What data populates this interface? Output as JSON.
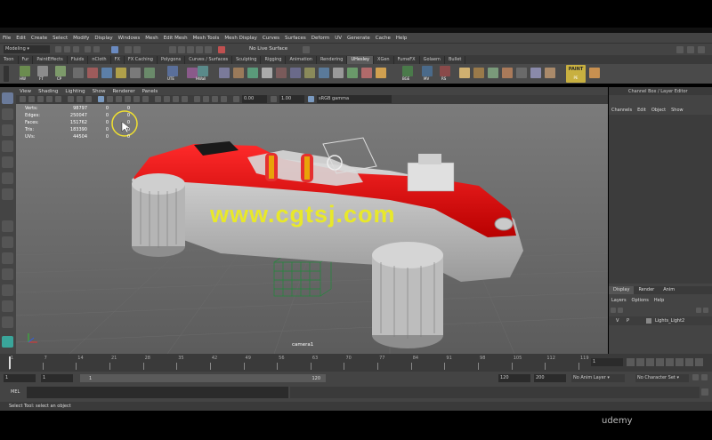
{
  "menu": [
    "File",
    "Edit",
    "Create",
    "Select",
    "Modify",
    "Display",
    "Windows",
    "Mesh",
    "Edit Mesh",
    "Mesh Tools",
    "Mesh Display",
    "Curves",
    "Surfaces",
    "Deform",
    "UV",
    "Generate",
    "Cache",
    "Help"
  ],
  "status_line": {
    "mode": "Modeling",
    "live_surface": "No Live Surface"
  },
  "shelf_tabs": [
    "Toon",
    "Fur",
    "PaintEffects",
    "Fluids",
    "nCloth",
    "FX",
    "FX Caching",
    "Polygons",
    "Curves / Surfaces",
    "Sculpting",
    "Rigging",
    "Animation",
    "Rendering",
    "UHesley",
    "XGen",
    "FumeFX",
    "Golaem",
    "Bullet"
  ],
  "active_shelf_tab": "UHesley",
  "shelf_icon_labels": [
    "HW",
    "FT",
    "CP",
    "UTE",
    "HWall",
    "BGE",
    "MV",
    "RS",
    "PE"
  ],
  "shelf_paint_label": "PAINT",
  "viewport_menu": [
    "View",
    "Shading",
    "Lighting",
    "Show",
    "Renderer",
    "Panels"
  ],
  "viewport_toolbar": {
    "value1": "0.00",
    "value2": "1.00",
    "color_space": "sRGB gamma"
  },
  "hud": [
    {
      "label": "Verts:",
      "v1": "98797",
      "v2": "0",
      "v3": "0"
    },
    {
      "label": "Edges:",
      "v1": "250047",
      "v2": "0",
      "v3": "0"
    },
    {
      "label": "Faces:",
      "v1": "151762",
      "v2": "0",
      "v3": "0"
    },
    {
      "label": "Tris:",
      "v1": "183390",
      "v2": "0",
      "v3": "0"
    },
    {
      "label": "UVs:",
      "v1": "44504",
      "v2": "0",
      "v3": "0"
    }
  ],
  "camera_label": "camera1",
  "watermark": "www.cgtsj.com",
  "channel_box": {
    "title": "Channel Box / Layer Editor",
    "menu": [
      "Channels",
      "Edit",
      "Object",
      "Show"
    ]
  },
  "layer_editor": {
    "tabs": [
      "Display",
      "Render",
      "Anim"
    ],
    "menu": [
      "Layers",
      "Options",
      "Help"
    ],
    "layer": {
      "v": "V",
      "p": "P",
      "name": "Lights_Light2"
    }
  },
  "timeline": {
    "ticks": [
      "1",
      "7",
      "14",
      "21",
      "28",
      "35",
      "42",
      "49",
      "56",
      "63",
      "70",
      "77",
      "84",
      "91",
      "98",
      "105",
      "112",
      "119"
    ],
    "current_frame": "1"
  },
  "range": {
    "start": "1",
    "start_inner": "1",
    "slider_start": "1",
    "slider_end": "120",
    "end_inner": "120",
    "end": "200",
    "anim_layer": "No Anim Layer",
    "character_set": "No Character Set"
  },
  "mel_label": "MEL",
  "help_line": "Select Tool: select an object",
  "udemy": "udemy"
}
